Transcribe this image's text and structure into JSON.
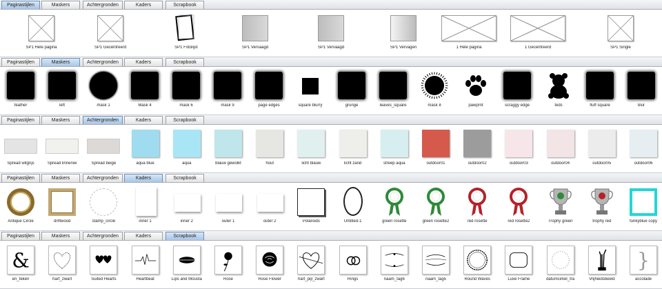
{
  "tabs": [
    "Paginastijlen",
    "Maskers",
    "Achtergronden",
    "Kaders",
    "Scrapbook"
  ],
  "rows": [
    {
      "active_tab": 0,
      "items": [
        {
          "label": "SP1 Hele pagina",
          "kind": "placeholder"
        },
        {
          "label": "SP1 Gecentreerd",
          "kind": "placeholder"
        },
        {
          "label": "SP1 Fotolijst",
          "kind": "photoframe"
        },
        {
          "label": "SP1 Vervaagd",
          "kind": "grey"
        },
        {
          "label": "SP1 Vervaagd",
          "kind": "grey"
        },
        {
          "label": "SP1 Vervagen",
          "kind": "greyv"
        },
        {
          "label": "1 Hele pagina",
          "kind": "wide"
        },
        {
          "label": "1 Gecentreerd",
          "kind": "wide"
        },
        {
          "label": "SP1 Single",
          "kind": "placeholder"
        }
      ]
    },
    {
      "active_tab": 1,
      "items": [
        {
          "label": "feather",
          "kind": "mask"
        },
        {
          "label": "left",
          "kind": "mask"
        },
        {
          "label": "mask 1",
          "kind": "mask-circle"
        },
        {
          "label": "Mask 4",
          "kind": "mask"
        },
        {
          "label": "mask 6",
          "kind": "mask"
        },
        {
          "label": "mask 9",
          "kind": "mask"
        },
        {
          "label": "page edges",
          "kind": "mask"
        },
        {
          "label": "square blurry",
          "kind": "mask-small"
        },
        {
          "label": "grunge",
          "kind": "mask"
        },
        {
          "label": "leaves_square",
          "kind": "mask"
        },
        {
          "label": "mask 8",
          "kind": "mask-sun"
        },
        {
          "label": "pawprnt",
          "kind": "mask-paw"
        },
        {
          "label": "scraggy edge",
          "kind": "mask"
        },
        {
          "label": "teds",
          "kind": "mask-teddy"
        },
        {
          "label": "fluff square",
          "kind": "mask"
        },
        {
          "label": "blur",
          "kind": "mask"
        }
      ]
    },
    {
      "active_tab": 2,
      "items": [
        {
          "label": "Spread witgrijs",
          "kind": "spread",
          "color": "#e4e4e4"
        },
        {
          "label": "Spread linnenwi",
          "kind": "spread",
          "color": "#f1f1ee"
        },
        {
          "label": "Spread beige",
          "kind": "spread",
          "color": "#dcd9d6"
        },
        {
          "label": "aqua blue",
          "kind": "bg",
          "color": "#9fdcf0"
        },
        {
          "label": "aqua",
          "kind": "bg",
          "color": "#a8e6f6"
        },
        {
          "label": "blauw gewolkt",
          "kind": "bg",
          "color": "#bfe6ea"
        },
        {
          "label": "hout",
          "kind": "bg",
          "color": "#e6e6e2"
        },
        {
          "label": "licht blauw",
          "kind": "bg",
          "color": "#e0f0ee"
        },
        {
          "label": "licht zand",
          "kind": "bg",
          "color": "#eeeeea"
        },
        {
          "label": "streep aqua",
          "kind": "bg",
          "color": "#d6eef0"
        },
        {
          "label": "outdoor01",
          "kind": "bg",
          "color": "#d55a4c"
        },
        {
          "label": "outdoor02",
          "kind": "bg",
          "color": "#9c9c9c"
        },
        {
          "label": "outdoor03",
          "kind": "bg",
          "color": "#f6e6ea"
        },
        {
          "label": "outdoor04",
          "kind": "bg",
          "color": "#f3e4e6"
        },
        {
          "label": "outdoor05",
          "kind": "bg",
          "color": "#ececec"
        },
        {
          "label": "outdoor06",
          "kind": "bg",
          "color": "#e6eef2"
        }
      ]
    },
    {
      "active_tab": 3,
      "items": [
        {
          "label": "Antique Circle",
          "kind": "frame-antique"
        },
        {
          "label": "driftwood",
          "kind": "frame-drift"
        },
        {
          "label": "stamp_circle",
          "kind": "frame-stamp"
        },
        {
          "label": "inner 1",
          "kind": "frame-paper"
        },
        {
          "label": "inner 2",
          "kind": "frame-paper-wide"
        },
        {
          "label": "outer 1",
          "kind": "frame-paper-wide"
        },
        {
          "label": "outer 2",
          "kind": "frame-paper-wide"
        },
        {
          "label": "Polaroids",
          "kind": "frame-polaroid"
        },
        {
          "label": "Untitled-1",
          "kind": "frame-oval"
        },
        {
          "label": "green rosette",
          "kind": "rosette",
          "color": "#2f8a3a"
        },
        {
          "label": "green rosette2",
          "kind": "rosette",
          "color": "#2f8a3a"
        },
        {
          "label": "red rosette",
          "kind": "rosette",
          "color": "#b4232a"
        },
        {
          "label": "red rosette2",
          "kind": "rosette",
          "color": "#b4232a"
        },
        {
          "label": "Trophy green",
          "kind": "trophy",
          "color": "#2f8a3a"
        },
        {
          "label": "trophy red",
          "kind": "trophy",
          "color": "#b4232a"
        },
        {
          "label": "funkyblue copy",
          "kind": "frame-funky"
        }
      ]
    },
    {
      "active_tab": 4,
      "items": [
        {
          "label": "en_teken",
          "kind": "amp"
        },
        {
          "label": "hart_zwart",
          "kind": "heart"
        },
        {
          "label": "Suited Hearts",
          "kind": "suits"
        },
        {
          "label": "Heartbeat",
          "kind": "beat"
        },
        {
          "label": "Lips and Mousta",
          "kind": "lips"
        },
        {
          "label": "Rose",
          "kind": "rose"
        },
        {
          "label": "Rose Flower",
          "kind": "roseflower"
        },
        {
          "label": "hart_pijl_zwart",
          "kind": "arrowheart"
        },
        {
          "label": "Rings",
          "kind": "rings"
        },
        {
          "label": "naam_tag6",
          "kind": "tag"
        },
        {
          "label": "naam_tag5",
          "kind": "tag2"
        },
        {
          "label": "Round Waves",
          "kind": "waves"
        },
        {
          "label": "Luxe Frame",
          "kind": "luxe"
        },
        {
          "label": "datumcirkel_tra",
          "kind": "dcircle"
        },
        {
          "label": "Vrijheidsbeeld",
          "kind": "liberty"
        },
        {
          "label": "accolade",
          "kind": "brace"
        }
      ]
    }
  ]
}
